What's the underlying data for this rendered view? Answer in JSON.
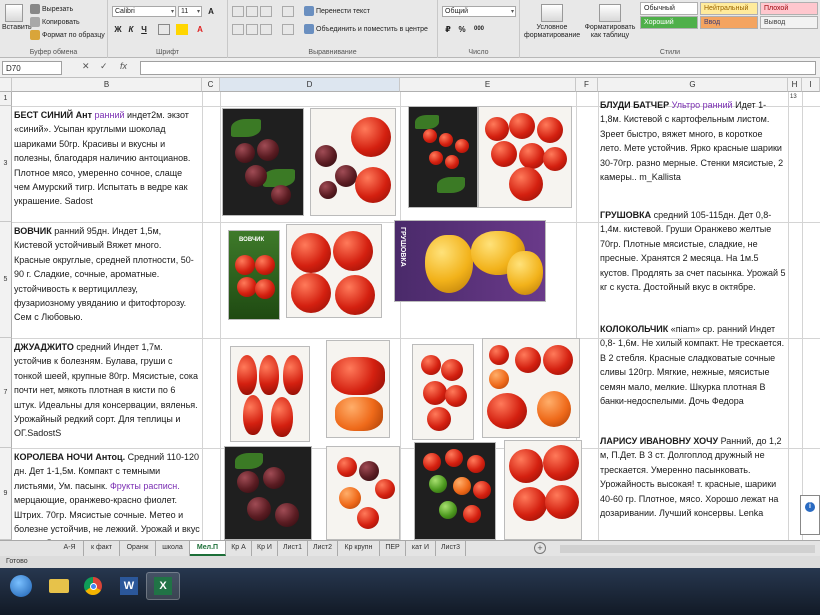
{
  "ribbon": {
    "clipboard": {
      "paste_label": "Вставить",
      "cut_label": "Вырезать",
      "copy_label": "Копировать",
      "format_painter_label": "Формат по образцу",
      "group_label": "Буфер обмена"
    },
    "font": {
      "font_name": "Calibri",
      "font_size": "11",
      "bold_label": "Ж",
      "italic_label": "К",
      "underline_label": "Ч",
      "group_label": "Шрифт"
    },
    "alignment": {
      "wrap_text_label": "Перенести текст",
      "merge_label": "Объединить и поместить в центре",
      "group_label": "Выравнивание"
    },
    "number": {
      "format_value": "Общий",
      "percent_label": "%",
      "thousands_label": "000",
      "group_label": "Число"
    },
    "styles": {
      "conditional_label": "Условное форматирование",
      "format_table_label": "Форматировать как таблицу",
      "cell_styles": [
        {
          "label": "Обычный",
          "bg": "#ffffff",
          "fg": "#222222"
        },
        {
          "label": "Нейтральный",
          "bg": "#ffeb9c",
          "fg": "#9c6500"
        },
        {
          "label": "Плохой",
          "bg": "#ffc7ce",
          "fg": "#9c0006"
        },
        {
          "label": "Хороший",
          "bg": "#4fb04a",
          "fg": "#ffffff"
        },
        {
          "label": "Ввод",
          "bg": "#f4a460",
          "fg": "#3f3f76"
        },
        {
          "label": "Вывод",
          "bg": "#f2f2f2",
          "fg": "#3f3f3f"
        }
      ],
      "group_label": "Стили"
    }
  },
  "formula_bar": {
    "name_box": "D70",
    "cancel_label": "✕",
    "enter_label": "✓",
    "fx_label": "fx",
    "formula_value": ""
  },
  "grid": {
    "columns": [
      "B",
      "C",
      "D",
      "E",
      "F",
      "G",
      "H",
      "I"
    ],
    "selected_column": "D",
    "rows": [
      "1",
      "3",
      "5",
      "7",
      "9"
    ],
    "h_col_fragment": "13",
    "cells_left": [
      {
        "name": "БЕСТ СИНИЙ Ант",
        "highlight": " ранний",
        "text": " индет2м. экзот «синий». Усыпан круглыми шоколад шариками 50гр. Красивы и вкусны и полезны, благодаря наличию антоцианов. Плотное мясо, умеренно сочное, слаще чем Амурский тигр. Испытать в ведре как украшение. Sadost"
      },
      {
        "name": "ВОВЧИК",
        "highlight": "",
        "text": " ранний 95дн. Индет 1,5м, Кистевой устойчивый Вяжет много. Красные округлые, средней плотности, 50-90 г. Сладкие, сочные, ароматные. устойчивость к вертициллезу, фузариозному увяданию и фитофторозу. Сем с Любовью."
      },
      {
        "name": "ДЖУАДЖИТО",
        "highlight": "",
        "text": " средний Индет 1,7м. устойчив к болезням. Булава, груши с тонкой шеей, крупные 80гр. Мясистые, сока почти нет, мякоть плотная в кисти по 6 штук. Идеальны для консервации, вяленья. Урожайный редкий сорт. Для теплицы и ОГ.SadostS"
      },
      {
        "name": "КОРОЛЕВА НОЧИ Антоц.",
        "highlight": "",
        "text": " Средний 110-120 дн. Дет 1-1,5м. Компакт с темными листьями, Ум. пасынк.",
        "highlight2": " Фрукты расписн.",
        "text2": " мерцающие, оранжево-красно фиолет. Штрих. 70гр. Мясистые сочные. Метео и болезне устойчив, не лежкий. Урожай и вкус хорош. Доча Федора"
      }
    ],
    "cells_right": [
      {
        "name": "БЛУДИ БАТЧЕР",
        "highlight": " Ультро ранний",
        "text": " Идет 1-1,8м. Кистевой с картофельным листом. Зреет быстро, вяжет много, в короткое лето. Мете устойчив. Ярко красные шарики 30-70гр. разно мерные. Стенки мясистые, 2 камеры.. m_Kallista"
      },
      {
        "name": "ГРУШОВКА",
        "highlight": "",
        "text": " средний 105-115дн. Дет 0,8-1,4м. кистевой. Груши Оранжево желтые 70гр. Плотные мясистые, сладкие, не пресные. Хранятся 2 месяца. На 1м.5 кустов. Продлять за счет пасынка. Урожай 5 кг с куста. Достойный вкус в октябре."
      },
      {
        "name": "КОЛОКОЛЬЧИК",
        "highlight": "",
        "text": " «пiam» ср. ранний Индет 0,8- 1,6м. Не хилый компакт. Не трескается. В 2 стебля. Красные сладковатые сочные сливы 120гр. Мягкие, нежные, мясистые семян мало, мелкие. Шкурка плотная В банки-недоспелыми. Дочь Федора"
      },
      {
        "name": "ЛАРИСУ ИВАНОВНУ ХОЧУ",
        "highlight": "",
        "text": " Ранний, до 1,2 м, П.Дет. В 3 ст. Долгоплод дружный не трескается. Умеренно пасынковать. Урожайность высокая! т. красные, шарики 40-60 гр. Плотное, мясо. Хорошо лежат на дозаривании. Лучший консервы. Lenka"
      }
    ],
    "packets": {
      "vovchik": "ВОВЧИК",
      "grushovka": "ГРУШОВКА"
    }
  },
  "sheet_tabs": {
    "tabs": [
      "А-Я",
      "к факт",
      "Оранж",
      "школа",
      "Мел.П",
      "Кр А",
      "Кр И",
      "Лист1",
      "Лист2",
      "Кр крупн",
      "ПЕР",
      "кат И",
      "Лист3"
    ],
    "active": "Мел.П",
    "add_label": "+"
  },
  "status_bar": {
    "text": "Готово"
  },
  "taskbar": {
    "items": [
      "start-button",
      "explorer-icon",
      "chrome-icon",
      "word-icon",
      "excel-icon"
    ],
    "active": "excel-icon"
  },
  "notification": {
    "icon_label": "i"
  }
}
